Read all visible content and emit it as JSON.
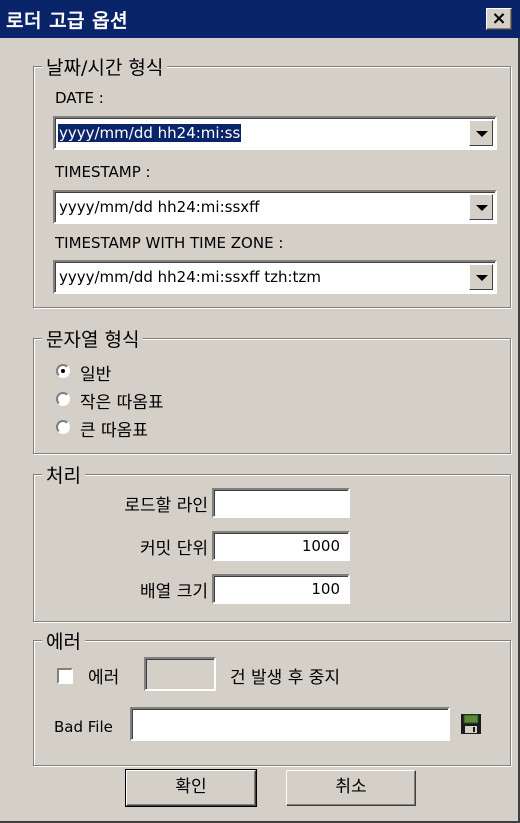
{
  "window": {
    "title": "로더 고급 옵션",
    "close_label": "×"
  },
  "datetime": {
    "legend": "날짜/시간 형식",
    "date_label": "DATE :",
    "date_value": "yyyy/mm/dd hh24:mi:ss",
    "timestamp_label": "TIMESTAMP :",
    "timestamp_value": "yyyy/mm/dd hh24:mi:ssxff",
    "tz_label": "TIMESTAMP WITH TIME ZONE :",
    "tz_value": "yyyy/mm/dd hh24:mi:ssxff tzh:tzm"
  },
  "string_format": {
    "legend": "문자열 형식",
    "options": [
      {
        "label": "일반",
        "checked": true
      },
      {
        "label": "작은 따옴표",
        "checked": false
      },
      {
        "label": "큰 따옴표",
        "checked": false
      }
    ]
  },
  "processing": {
    "legend": "처리",
    "load_lines_label": "로드할 라인",
    "load_lines_value": "",
    "commit_unit_label": "커밋 단위",
    "commit_unit_value": "1000",
    "array_size_label": "배열 크기",
    "array_size_value": "100"
  },
  "error": {
    "legend": "에러",
    "checkbox_label": "에러",
    "count_value": "",
    "suffix_label": "건 발생 후 중지",
    "bad_file_label": "Bad File",
    "bad_file_value": ""
  },
  "buttons": {
    "ok": "확인",
    "cancel": "취소"
  }
}
